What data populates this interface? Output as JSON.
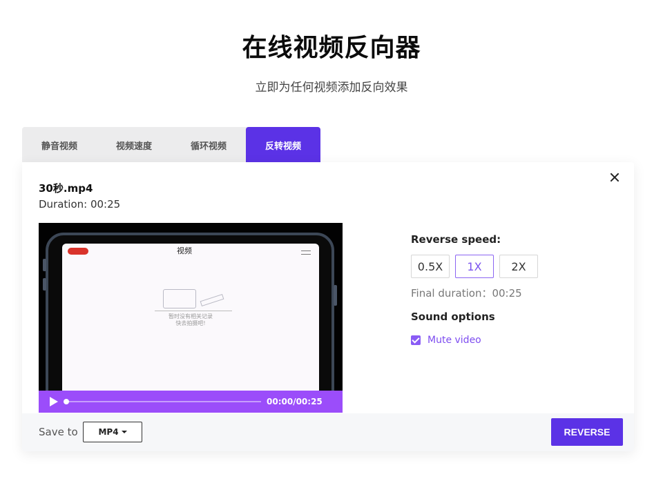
{
  "header": {
    "title": "在线视频反向器",
    "subtitle": "立即为任何视频添加反向效果"
  },
  "tabs": [
    {
      "label": "静音视频",
      "active": false
    },
    {
      "label": "视频速度",
      "active": false
    },
    {
      "label": "循环视频",
      "active": false
    },
    {
      "label": "反转视频",
      "active": true
    }
  ],
  "file": {
    "name": "30秒.mp4",
    "duration": "Duration: 00:25"
  },
  "video": {
    "screen_title": "视频",
    "empty_message_line1": "暂时没有相关记录",
    "empty_message_line2": "快去拍摄吧!",
    "time_display": "00:00/00:25",
    "progress": 0
  },
  "options": {
    "speed_label": "Reverse speed:",
    "speeds": [
      "0.5X",
      "1X",
      "2X"
    ],
    "selected_speed": "1X",
    "final_duration": "Final duration：00:25",
    "sound_label": "Sound options",
    "mute_label": "Mute video",
    "mute_checked": true
  },
  "footer": {
    "save_label": "Save to",
    "format": "MP4",
    "reverse_label": "REVERSE"
  },
  "colors": {
    "accent": "#5b32e6",
    "player_bar": "#9b4dfa",
    "checkbox": "#8a5cf5"
  }
}
